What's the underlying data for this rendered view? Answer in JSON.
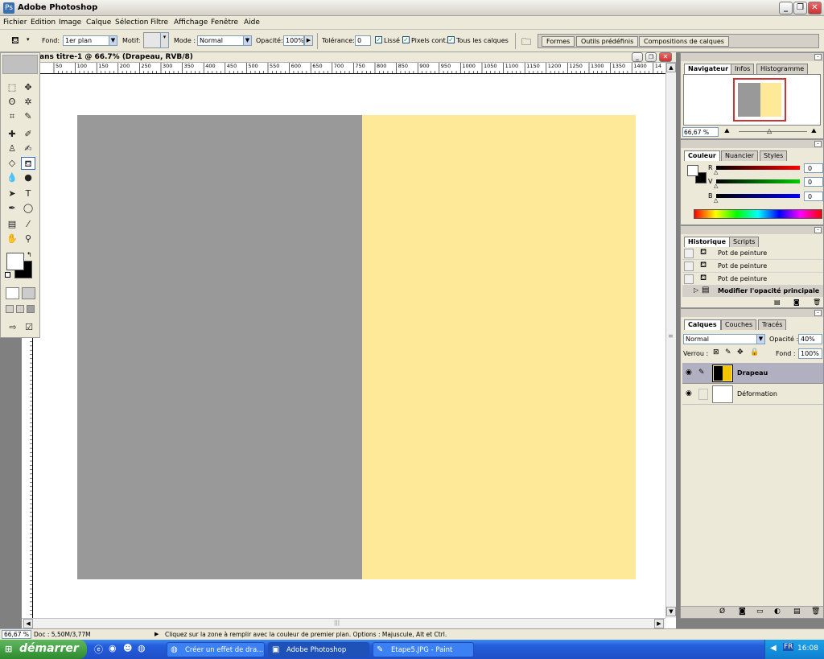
{
  "window": {
    "title": "Adobe Photoshop"
  },
  "menu": [
    "Fichier",
    "Edition",
    "Image",
    "Calque",
    "Sélection",
    "Filtre",
    "Affichage",
    "Fenêtre",
    "Aide"
  ],
  "options": {
    "fond_label": "Fond:",
    "fond_value": "1er plan",
    "motif_label": "Motif:",
    "mode_label": "Mode :",
    "mode_value": "Normal",
    "opacite_label": "Opacité:",
    "opacite_value": "100%",
    "tolerance_label": "Tolérance:",
    "tolerance_value": "0",
    "lisse_label": "Lissé",
    "pixels_cont_label": "Pixels cont.",
    "tous_calques_label": "Tous les calques",
    "well_tabs": [
      "Formes",
      "Outils prédéfinis",
      "Compositions de calques"
    ]
  },
  "document": {
    "title": "ans titre-1 @ 66.7% (Drapeau, RVB/8)",
    "hruler_ticks": [
      "50",
      "100",
      "150",
      "200",
      "250",
      "300",
      "350",
      "400",
      "450",
      "500",
      "550",
      "600",
      "650",
      "700",
      "750",
      "800",
      "850",
      "900",
      "950",
      "1000",
      "1050",
      "1100",
      "1150",
      "1200",
      "1250",
      "1300",
      "1350",
      "1400",
      "14"
    ],
    "left_color": "#999999",
    "right_color": "#fde998"
  },
  "navigator": {
    "tabs": [
      "Navigateur",
      "Infos",
      "Histogramme"
    ],
    "zoom": "66,67 %"
  },
  "color_panel": {
    "tabs": [
      "Couleur",
      "Nuancier",
      "Styles"
    ],
    "channels": [
      {
        "label": "R",
        "value": "0"
      },
      {
        "label": "V",
        "value": "0"
      },
      {
        "label": "B",
        "value": "0"
      }
    ]
  },
  "history": {
    "tabs": [
      "Historique",
      "Scripts"
    ],
    "items": [
      "Pot de peinture",
      "Pot de peinture",
      "Pot de peinture",
      "Modifier l'opacité principale"
    ]
  },
  "layers": {
    "tabs": [
      "Calques",
      "Couches",
      "Tracés"
    ],
    "blend_mode": "Normal",
    "opacite_label": "Opacité :",
    "opacite_value": "40%",
    "verrou_label": "Verrou :",
    "fond_label": "Fond :",
    "fond_value": "100%",
    "items": [
      {
        "name": "Drapeau"
      },
      {
        "name": "Déformation"
      }
    ]
  },
  "status": {
    "zoom": "66,67 %",
    "doc": "Doc : 5,50M/3,77M",
    "hint": "Cliquez sur la zone à remplir avec la couleur de premier plan. Options : Majuscule, Alt et Ctrl."
  },
  "taskbar": {
    "start": "démarrer",
    "buttons": [
      "Créer un effet de dra...",
      "Adobe Photoshop",
      "Etape5.JPG - Paint"
    ],
    "lang": "FR",
    "time": "16:08"
  }
}
